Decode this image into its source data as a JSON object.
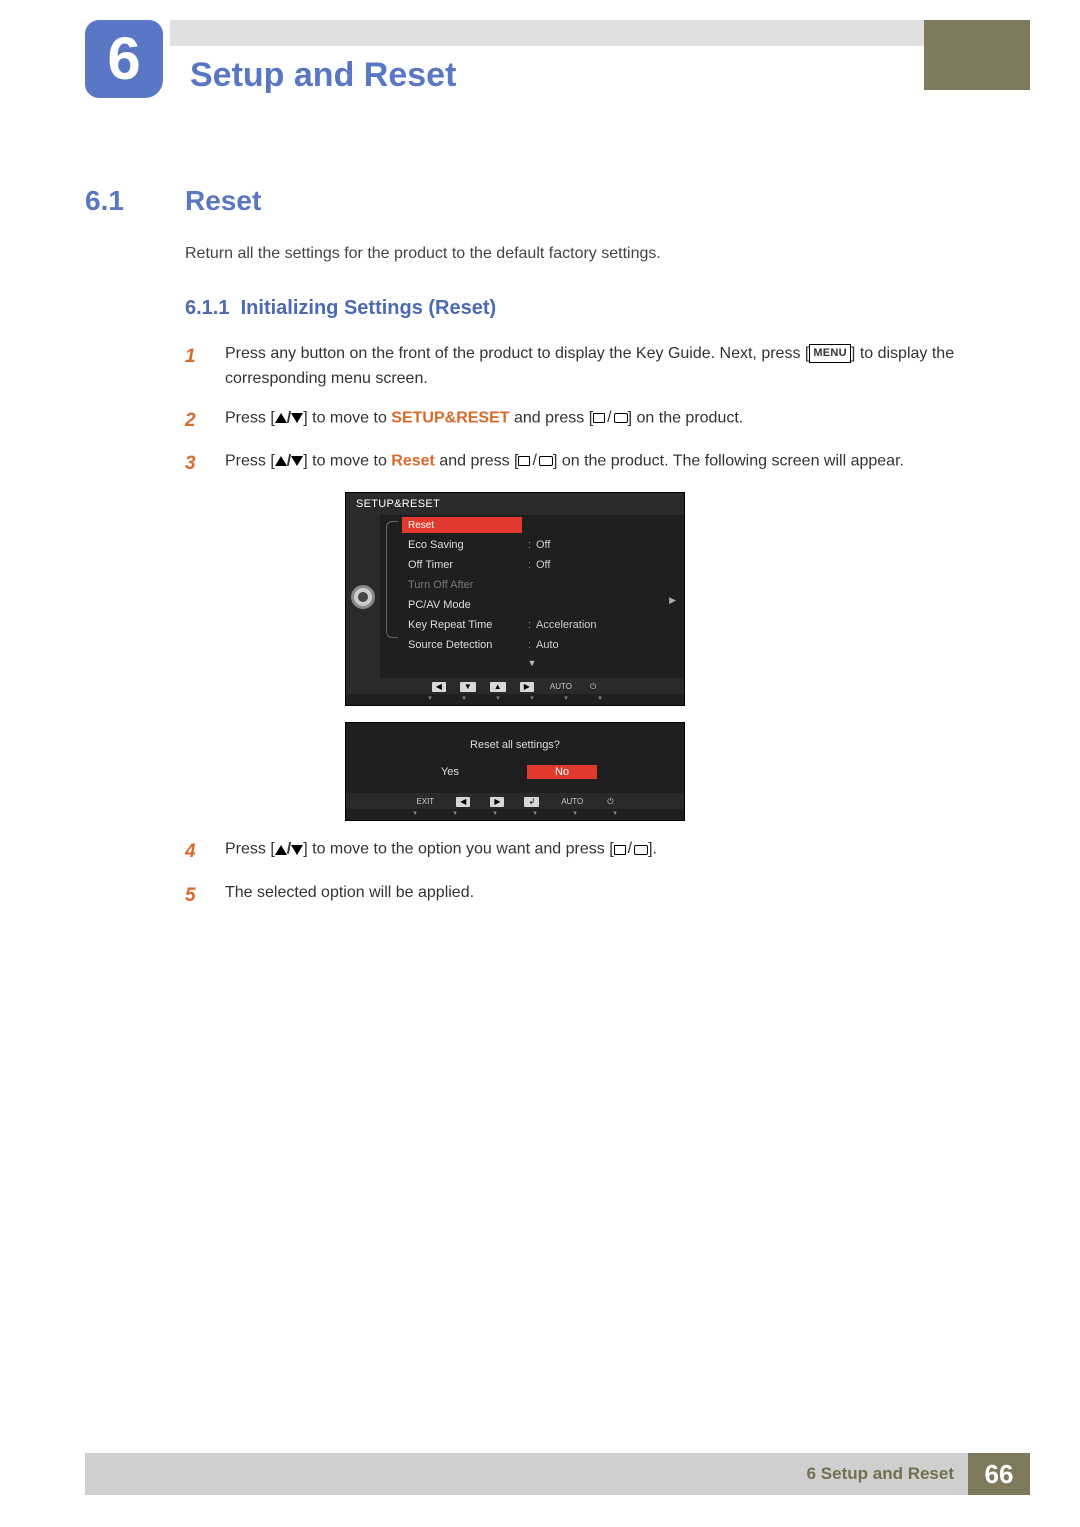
{
  "header": {
    "chapter_number": "6",
    "chapter_title": "Setup and Reset"
  },
  "section": {
    "number": "6.1",
    "title": "Reset",
    "intro": "Return all the settings for the product to the default factory settings."
  },
  "subsection": {
    "number": "6.1.1",
    "title": "Initializing Settings (Reset)"
  },
  "steps": {
    "s1_a": "Press any button on the front of the product to display the Key Guide. Next, press [",
    "s1_menu": "MENU",
    "s1_b": "] to display the corresponding menu screen.",
    "s2_a": "Press [",
    "s2_b": "] to move to ",
    "s2_kw": "SETUP&RESET",
    "s2_c": " and press [",
    "s2_d": "] on the product.",
    "s3_a": "Press [",
    "s3_b": "] to move to ",
    "s3_kw": "Reset",
    "s3_c": " and press [",
    "s3_d": "] on the product. The following screen will appear.",
    "s4_a": "Press [",
    "s4_b": "] to move to the option you want and press [",
    "s4_c": "].",
    "s5": "The selected option will be applied."
  },
  "step_numbers": {
    "n1": "1",
    "n2": "2",
    "n3": "3",
    "n4": "4",
    "n5": "5"
  },
  "osd": {
    "title": "SETUP&RESET",
    "items": [
      {
        "label": "Reset",
        "value": "",
        "selected": true
      },
      {
        "label": "Eco Saving",
        "value": "Off"
      },
      {
        "label": "Off Timer",
        "value": "Off"
      },
      {
        "label": "Turn Off After",
        "value": "",
        "dim": true
      },
      {
        "label": "PC/AV Mode",
        "value": ""
      },
      {
        "label": "Key Repeat Time",
        "value": "Acceleration"
      },
      {
        "label": "Source Detection",
        "value": "Auto"
      }
    ],
    "nav": {
      "auto": "AUTO"
    }
  },
  "dialog": {
    "question": "Reset all settings?",
    "yes": "Yes",
    "no": "No",
    "exit": "EXIT",
    "auto": "AUTO"
  },
  "footer": {
    "text": "6 Setup and Reset",
    "page": "66"
  }
}
